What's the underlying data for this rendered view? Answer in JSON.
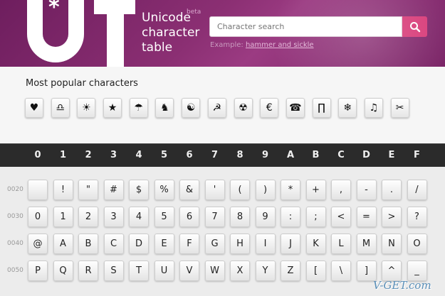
{
  "header": {
    "title": "Unicode character table",
    "title_lines": [
      "Unicode",
      "character",
      "table"
    ],
    "beta": "beta",
    "search_placeholder": "Character search",
    "example_prefix": "Example:",
    "example_link": "hammer and sickle"
  },
  "popular": {
    "title": "Most popular characters",
    "chars": [
      "♥",
      "♎",
      "☀",
      "★",
      "☂",
      "♞",
      "☯",
      "☭",
      "☢",
      "€",
      "☎",
      "∏",
      "❄",
      "♫",
      "✂"
    ]
  },
  "hex_columns": [
    "0",
    "1",
    "2",
    "3",
    "4",
    "5",
    "6",
    "7",
    "8",
    "9",
    "A",
    "B",
    "C",
    "D",
    "E",
    "F"
  ],
  "rows": [
    {
      "label": "0020",
      "cells": [
        "",
        "!",
        "\"",
        "#",
        "$",
        "%",
        "&",
        "'",
        "(",
        ")",
        "*",
        "+",
        ",",
        "-",
        ".",
        "/"
      ]
    },
    {
      "label": "0030",
      "cells": [
        "0",
        "1",
        "2",
        "3",
        "4",
        "5",
        "6",
        "7",
        "8",
        "9",
        ":",
        ";",
        "<",
        "=",
        ">",
        "?"
      ]
    },
    {
      "label": "0040",
      "cells": [
        "@",
        "A",
        "B",
        "C",
        "D",
        "E",
        "F",
        "G",
        "H",
        "I",
        "J",
        "K",
        "L",
        "M",
        "N",
        "O"
      ]
    },
    {
      "label": "0050",
      "cells": [
        "P",
        "Q",
        "R",
        "S",
        "T",
        "U",
        "V",
        "W",
        "X",
        "Y",
        "Z",
        "[",
        "\\",
        "]",
        "^",
        "_"
      ]
    }
  ],
  "watermark": "V-GET.com",
  "colors": {
    "header": "#8b2f73",
    "search_button": "#d83d7a",
    "hexbar": "#2b2b2b"
  }
}
